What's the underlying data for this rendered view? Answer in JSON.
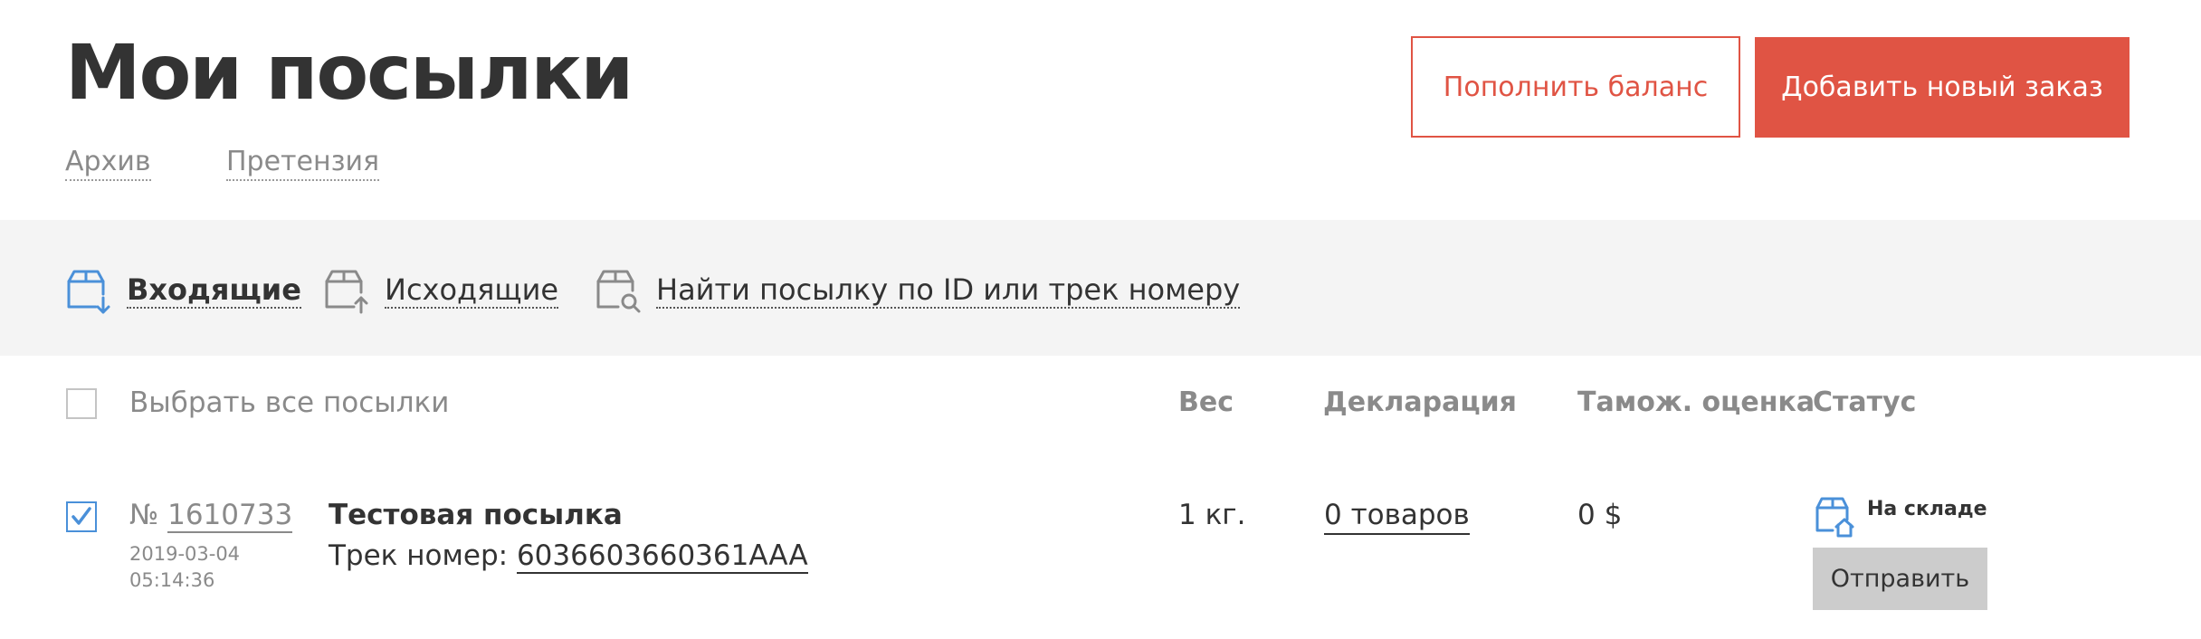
{
  "header": {
    "title": "Мои посылки",
    "links": [
      "Архив",
      "Претензия"
    ],
    "topup_label": "Пополнить баланс",
    "new_order_label": "Добавить новый заказ"
  },
  "toolbar": {
    "items": [
      {
        "label": "Входящие",
        "icon": "incoming-box-icon",
        "active": true
      },
      {
        "label": "Исходящие",
        "icon": "outgoing-box-icon",
        "active": false
      },
      {
        "label": "Найти посылку по ID или трек номеру",
        "icon": "search-box-icon",
        "active": false
      }
    ]
  },
  "table": {
    "select_all_label": "Выбрать все посылки",
    "columns": [
      "Вес",
      "Декларация",
      "Тамож. оценка",
      "Статус"
    ],
    "rows": [
      {
        "checked": true,
        "number_prefix": "№",
        "number": "1610733",
        "date": "2019-03-04",
        "time": "05:14:36",
        "name": "Тестовая посылка",
        "track_label": "Трек номер:",
        "track_number": "6036603660361AAA",
        "weight": "1 кг.",
        "declaration": "0 товаров",
        "customs": "0 $",
        "status": "На складе",
        "status_icon": "warehouse-box-icon",
        "action_label": "Отправить"
      }
    ]
  },
  "colors": {
    "accent": "#e05444",
    "icon_blue": "#4a90d9",
    "toolbar_bg": "#f4f4f4",
    "muted_text": "#8a8a8a"
  }
}
